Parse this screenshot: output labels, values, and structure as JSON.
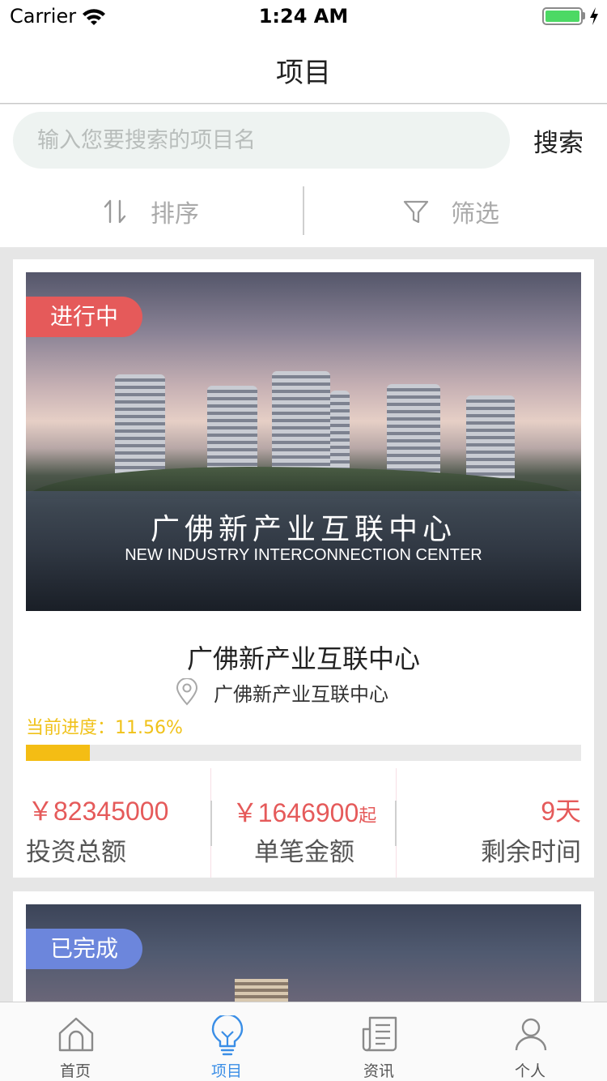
{
  "status_bar": {
    "carrier": "Carrier",
    "time": "1:24 AM"
  },
  "nav": {
    "title": "项目"
  },
  "search": {
    "placeholder": "输入您要搜索的项目名",
    "value": "",
    "button_label": "搜索"
  },
  "toolbar": {
    "sort_label": "排序",
    "filter_label": "筛选"
  },
  "projects": [
    {
      "status": "进行中",
      "status_color": "#e55a5a",
      "image_title_cn": "广佛新产业互联中心",
      "image_title_en": "NEW INDUSTRY INTERCONNECTION CENTER",
      "name": "广佛新产业互联中心",
      "location": "广佛新产业互联中心",
      "progress_label": "当前进度：11.56%",
      "progress_percent": 11.56,
      "total_investment": "￥82345000",
      "total_investment_label": "投资总额",
      "single_amount": "￥1646900",
      "single_amount_suffix": "起",
      "single_amount_label": "单笔金额",
      "remaining": "9天",
      "remaining_label": "剩余时间"
    },
    {
      "status": "已完成",
      "status_color": "#6c86dc"
    }
  ],
  "tabs": [
    {
      "label": "首页",
      "icon": "home-icon",
      "active": false
    },
    {
      "label": "项目",
      "icon": "lightbulb-icon",
      "active": true
    },
    {
      "label": "资讯",
      "icon": "news-icon",
      "active": false
    },
    {
      "label": "个人",
      "icon": "person-icon",
      "active": false
    }
  ],
  "colors": {
    "accent": "#3a8ee6",
    "price": "#e55a5a",
    "progress": "#f4bd14"
  }
}
